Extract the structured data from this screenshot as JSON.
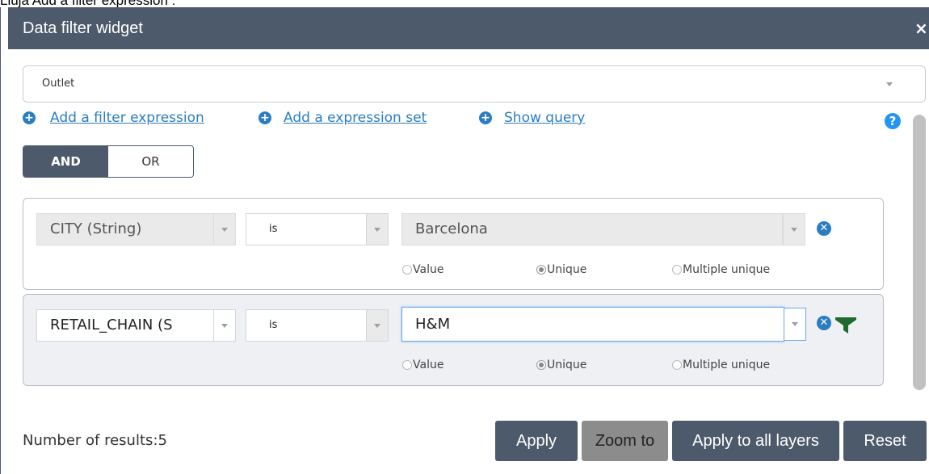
{
  "caption": "Lluja Add a filter expression :",
  "window": {
    "title": "Data filter widget",
    "close_glyph": "×"
  },
  "layer_select": {
    "value": "Outlet"
  },
  "links": {
    "add_expression": "Add a filter expression",
    "add_set": "Add a expression set",
    "show_query": "Show query"
  },
  "help_glyph": "?",
  "logic": {
    "and": "AND",
    "or": "OR",
    "selected": "AND"
  },
  "expressions": [
    {
      "field": "CITY (String)",
      "operator": "is",
      "value": "Barcelona",
      "radio_value": "Value",
      "radio_unique": "Unique",
      "radio_multiple": "Multiple unique",
      "selected_mode": "Unique"
    },
    {
      "field": "RETAIL_CHAIN (S",
      "operator": "is",
      "value": "H&M",
      "radio_value": "Value",
      "radio_unique": "Unique",
      "radio_multiple": "Multiple unique",
      "selected_mode": "Unique"
    }
  ],
  "results": {
    "label": "Number of results:5"
  },
  "buttons": {
    "apply": "Apply",
    "zoom": "Zoom to",
    "apply_all": "Apply to all layers",
    "reset": "Reset"
  },
  "colors": {
    "header": "#4d5a6b",
    "link": "#2a7dc1",
    "filter_icon": "#1f6b2e"
  },
  "icons": [
    "plus-circle-icon",
    "help-icon",
    "remove-circle-icon",
    "filter-funnel-icon",
    "chevron-down-icon",
    "close-icon"
  ]
}
